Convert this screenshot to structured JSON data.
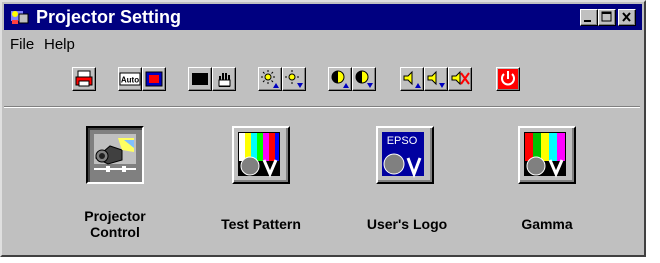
{
  "window": {
    "title": "Projector Setting"
  },
  "menu": {
    "file": "File",
    "help": "Help"
  },
  "toolbar": {
    "auto_label": "Auto"
  },
  "main": {
    "items": [
      {
        "label": "Projector Control"
      },
      {
        "label": "Test Pattern"
      },
      {
        "label": "User's Logo",
        "logo_text": "EPSO"
      },
      {
        "label": "Gamma"
      }
    ]
  },
  "colors": {
    "title_bar": "#000080",
    "face": "#c0c0c0",
    "power_red": "#ff0000",
    "accent_blue": "#0000c0"
  }
}
